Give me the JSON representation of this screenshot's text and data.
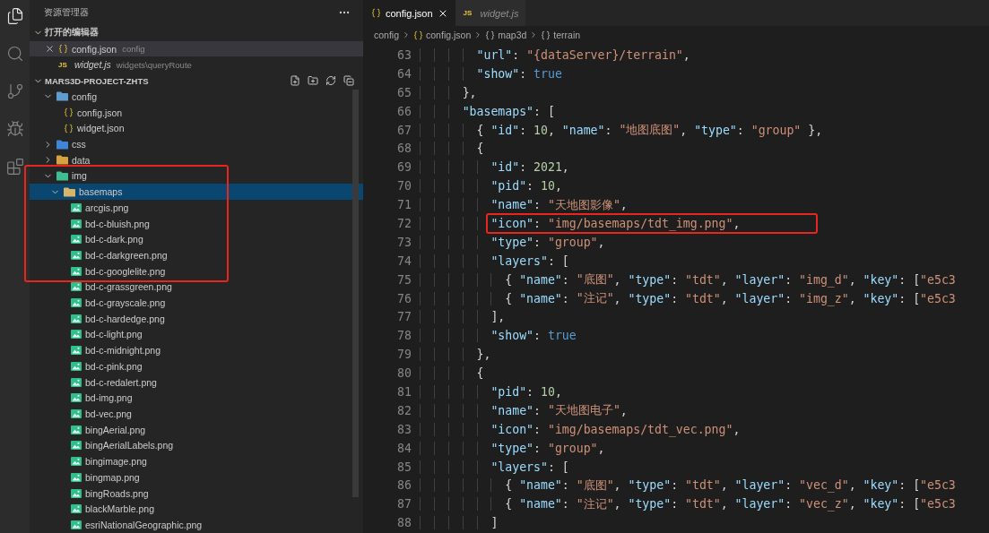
{
  "activity_bar": [
    {
      "kind": "explorer",
      "selected": true
    },
    {
      "kind": "search",
      "selected": false
    },
    {
      "kind": "scm",
      "selected": false
    },
    {
      "kind": "debug",
      "selected": false
    },
    {
      "kind": "extensions",
      "selected": false
    }
  ],
  "explorer": {
    "title": "资源管理器",
    "open_editors": {
      "label": "打开的编辑器",
      "expanded": true,
      "items": [
        {
          "kind": "json",
          "name": "config.json",
          "path": "config",
          "selected": true,
          "preview": false
        },
        {
          "kind": "js",
          "icon_label": "JS",
          "name": "widget.js",
          "path": "widgets\\queryRoute",
          "selected": false,
          "preview": true
        }
      ]
    },
    "project": {
      "label": "MARS3D-PROJECT-ZHTS",
      "expanded": true,
      "tree": [
        {
          "kind": "folder",
          "name": "config",
          "color": "#5f9ccf",
          "expanded": true,
          "selected": false,
          "children": [
            {
              "kind": "json",
              "name": "config.json",
              "selected": false
            },
            {
              "kind": "json",
              "name": "widget.json",
              "selected": false
            }
          ]
        },
        {
          "kind": "folder",
          "name": "css",
          "color": "#3f86d6",
          "expanded": false,
          "selected": false
        },
        {
          "kind": "folder",
          "name": "data",
          "color": "#d8a23e",
          "expanded": false,
          "selected": false
        },
        {
          "kind": "folder",
          "name": "img",
          "color": "#3fbf8f",
          "expanded": true,
          "selected": false,
          "annotated": true,
          "children": [
            {
              "kind": "folder",
              "name": "basemaps",
              "color": "#d9b56c",
              "expanded": true,
              "selected": true,
              "annotated": true,
              "children": [
                {
                  "kind": "image",
                  "name": "arcgis.png",
                  "selected": false,
                  "annotated": true
                },
                {
                  "kind": "image",
                  "name": "bd-c-bluish.png",
                  "selected": false,
                  "annotated": true
                },
                {
                  "kind": "image",
                  "name": "bd-c-dark.png",
                  "selected": false,
                  "annotated": true
                },
                {
                  "kind": "image",
                  "name": "bd-c-darkgreen.png",
                  "selected": false,
                  "annotated": true
                },
                {
                  "kind": "image",
                  "name": "bd-c-googlelite.png",
                  "selected": false,
                  "annotated": true
                },
                {
                  "kind": "image",
                  "name": "bd-c-grassgreen.png",
                  "selected": false
                },
                {
                  "kind": "image",
                  "name": "bd-c-grayscale.png",
                  "selected": false
                },
                {
                  "kind": "image",
                  "name": "bd-c-hardedge.png",
                  "selected": false
                },
                {
                  "kind": "image",
                  "name": "bd-c-light.png",
                  "selected": false
                },
                {
                  "kind": "image",
                  "name": "bd-c-midnight.png",
                  "selected": false
                },
                {
                  "kind": "image",
                  "name": "bd-c-pink.png",
                  "selected": false
                },
                {
                  "kind": "image",
                  "name": "bd-c-redalert.png",
                  "selected": false
                },
                {
                  "kind": "image",
                  "name": "bd-img.png",
                  "selected": false
                },
                {
                  "kind": "image",
                  "name": "bd-vec.png",
                  "selected": false
                },
                {
                  "kind": "image",
                  "name": "bingAerial.png",
                  "selected": false
                },
                {
                  "kind": "image",
                  "name": "bingAerialLabels.png",
                  "selected": false
                },
                {
                  "kind": "image",
                  "name": "bingimage.png",
                  "selected": false
                },
                {
                  "kind": "image",
                  "name": "bingmap.png",
                  "selected": false
                },
                {
                  "kind": "image",
                  "name": "bingRoads.png",
                  "selected": false
                },
                {
                  "kind": "image",
                  "name": "blackMarble.png",
                  "selected": false
                },
                {
                  "kind": "image",
                  "name": "esriNationalGeographic.png",
                  "selected": false
                }
              ]
            }
          ]
        }
      ]
    }
  },
  "tabs": [
    {
      "kind": "json",
      "label": "config.json",
      "selected": true,
      "preview": false
    },
    {
      "kind": "js",
      "icon_label": "JS",
      "label": "widget.js",
      "selected": false,
      "preview": true
    }
  ],
  "breadcrumb": [
    {
      "kind": "folder",
      "label": "config"
    },
    {
      "kind": "json",
      "label": "config.json"
    },
    {
      "kind": "object",
      "label": "map3d"
    },
    {
      "kind": "object",
      "label": "terrain"
    }
  ],
  "code": [
    {
      "number": "63",
      "tokens": [
        {
          "kind": "key",
          "text": "        \"url\""
        },
        {
          "kind": "punct",
          "text": ": "
        },
        {
          "kind": "string",
          "text": "\"{dataServer}/terrain\""
        },
        {
          "kind": "punct",
          "text": ","
        }
      ]
    },
    {
      "number": "64",
      "tokens": [
        {
          "kind": "key",
          "text": "        \"show\""
        },
        {
          "kind": "punct",
          "text": ": "
        },
        {
          "kind": "bool",
          "text": "true"
        }
      ]
    },
    {
      "number": "65",
      "tokens": [
        {
          "kind": "punct",
          "text": "      },"
        }
      ]
    },
    {
      "number": "66",
      "tokens": [
        {
          "kind": "key",
          "text": "      \"basemaps\""
        },
        {
          "kind": "punct",
          "text": ": ["
        }
      ]
    },
    {
      "number": "67",
      "tokens": [
        {
          "kind": "punct",
          "text": "        { "
        },
        {
          "kind": "key",
          "text": "\"id\""
        },
        {
          "kind": "punct",
          "text": ": "
        },
        {
          "kind": "number",
          "text": "10"
        },
        {
          "kind": "punct",
          "text": ", "
        },
        {
          "kind": "key",
          "text": "\"name\""
        },
        {
          "kind": "punct",
          "text": ": "
        },
        {
          "kind": "string",
          "text": "\"地图底图\""
        },
        {
          "kind": "punct",
          "text": ", "
        },
        {
          "kind": "key",
          "text": "\"type\""
        },
        {
          "kind": "punct",
          "text": ": "
        },
        {
          "kind": "string",
          "text": "\"group\""
        },
        {
          "kind": "punct",
          "text": " },"
        }
      ]
    },
    {
      "number": "68",
      "tokens": [
        {
          "kind": "punct",
          "text": "        {"
        }
      ]
    },
    {
      "number": "69",
      "tokens": [
        {
          "kind": "key",
          "text": "          \"id\""
        },
        {
          "kind": "punct",
          "text": ": "
        },
        {
          "kind": "number",
          "text": "2021"
        },
        {
          "kind": "punct",
          "text": ","
        }
      ]
    },
    {
      "number": "70",
      "tokens": [
        {
          "kind": "key",
          "text": "          \"pid\""
        },
        {
          "kind": "punct",
          "text": ": "
        },
        {
          "kind": "number",
          "text": "10"
        },
        {
          "kind": "punct",
          "text": ","
        }
      ]
    },
    {
      "number": "71",
      "tokens": [
        {
          "kind": "key",
          "text": "          \"name\""
        },
        {
          "kind": "punct",
          "text": ": "
        },
        {
          "kind": "string",
          "text": "\"天地图影像\""
        },
        {
          "kind": "punct",
          "text": ","
        }
      ]
    },
    {
      "number": "72",
      "annotated": true,
      "tokens": [
        {
          "kind": "key",
          "text": "          \"icon\""
        },
        {
          "kind": "punct",
          "text": ": "
        },
        {
          "kind": "string",
          "text": "\"img/basemaps/tdt_img.png\""
        },
        {
          "kind": "punct",
          "text": ","
        }
      ]
    },
    {
      "number": "73",
      "tokens": [
        {
          "kind": "key",
          "text": "          \"type\""
        },
        {
          "kind": "punct",
          "text": ": "
        },
        {
          "kind": "string",
          "text": "\"group\""
        },
        {
          "kind": "punct",
          "text": ","
        }
      ]
    },
    {
      "number": "74",
      "tokens": [
        {
          "kind": "key",
          "text": "          \"layers\""
        },
        {
          "kind": "punct",
          "text": ": ["
        }
      ]
    },
    {
      "number": "75",
      "tokens": [
        {
          "kind": "punct",
          "text": "            { "
        },
        {
          "kind": "key",
          "text": "\"name\""
        },
        {
          "kind": "punct",
          "text": ": "
        },
        {
          "kind": "string",
          "text": "\"底图\""
        },
        {
          "kind": "punct",
          "text": ", "
        },
        {
          "kind": "key",
          "text": "\"type\""
        },
        {
          "kind": "punct",
          "text": ": "
        },
        {
          "kind": "string",
          "text": "\"tdt\""
        },
        {
          "kind": "punct",
          "text": ", "
        },
        {
          "kind": "key",
          "text": "\"layer\""
        },
        {
          "kind": "punct",
          "text": ": "
        },
        {
          "kind": "string",
          "text": "\"img_d\""
        },
        {
          "kind": "punct",
          "text": ", "
        },
        {
          "kind": "key",
          "text": "\"key\""
        },
        {
          "kind": "punct",
          "text": ": ["
        },
        {
          "kind": "string",
          "text": "\"e5c3"
        }
      ]
    },
    {
      "number": "76",
      "tokens": [
        {
          "kind": "punct",
          "text": "            { "
        },
        {
          "kind": "key",
          "text": "\"name\""
        },
        {
          "kind": "punct",
          "text": ": "
        },
        {
          "kind": "string",
          "text": "\"注记\""
        },
        {
          "kind": "punct",
          "text": ", "
        },
        {
          "kind": "key",
          "text": "\"type\""
        },
        {
          "kind": "punct",
          "text": ": "
        },
        {
          "kind": "string",
          "text": "\"tdt\""
        },
        {
          "kind": "punct",
          "text": ", "
        },
        {
          "kind": "key",
          "text": "\"layer\""
        },
        {
          "kind": "punct",
          "text": ": "
        },
        {
          "kind": "string",
          "text": "\"img_z\""
        },
        {
          "kind": "punct",
          "text": ", "
        },
        {
          "kind": "key",
          "text": "\"key\""
        },
        {
          "kind": "punct",
          "text": ": ["
        },
        {
          "kind": "string",
          "text": "\"e5c3"
        }
      ]
    },
    {
      "number": "77",
      "tokens": [
        {
          "kind": "punct",
          "text": "          ],"
        }
      ]
    },
    {
      "number": "78",
      "tokens": [
        {
          "kind": "key",
          "text": "          \"show\""
        },
        {
          "kind": "punct",
          "text": ": "
        },
        {
          "kind": "bool",
          "text": "true"
        }
      ]
    },
    {
      "number": "79",
      "tokens": [
        {
          "kind": "punct",
          "text": "        },"
        }
      ]
    },
    {
      "number": "80",
      "tokens": [
        {
          "kind": "punct",
          "text": "        {"
        }
      ]
    },
    {
      "number": "81",
      "tokens": [
        {
          "kind": "key",
          "text": "          \"pid\""
        },
        {
          "kind": "punct",
          "text": ": "
        },
        {
          "kind": "number",
          "text": "10"
        },
        {
          "kind": "punct",
          "text": ","
        }
      ]
    },
    {
      "number": "82",
      "tokens": [
        {
          "kind": "key",
          "text": "          \"name\""
        },
        {
          "kind": "punct",
          "text": ": "
        },
        {
          "kind": "string",
          "text": "\"天地图电子\""
        },
        {
          "kind": "punct",
          "text": ","
        }
      ]
    },
    {
      "number": "83",
      "tokens": [
        {
          "kind": "key",
          "text": "          \"icon\""
        },
        {
          "kind": "punct",
          "text": ": "
        },
        {
          "kind": "string",
          "text": "\"img/basemaps/tdt_vec.png\""
        },
        {
          "kind": "punct",
          "text": ","
        }
      ]
    },
    {
      "number": "84",
      "tokens": [
        {
          "kind": "key",
          "text": "          \"type\""
        },
        {
          "kind": "punct",
          "text": ": "
        },
        {
          "kind": "string",
          "text": "\"group\""
        },
        {
          "kind": "punct",
          "text": ","
        }
      ]
    },
    {
      "number": "85",
      "tokens": [
        {
          "kind": "key",
          "text": "          \"layers\""
        },
        {
          "kind": "punct",
          "text": ": ["
        }
      ]
    },
    {
      "number": "86",
      "tokens": [
        {
          "kind": "punct",
          "text": "            { "
        },
        {
          "kind": "key",
          "text": "\"name\""
        },
        {
          "kind": "punct",
          "text": ": "
        },
        {
          "kind": "string",
          "text": "\"底图\""
        },
        {
          "kind": "punct",
          "text": ", "
        },
        {
          "kind": "key",
          "text": "\"type\""
        },
        {
          "kind": "punct",
          "text": ": "
        },
        {
          "kind": "string",
          "text": "\"tdt\""
        },
        {
          "kind": "punct",
          "text": ", "
        },
        {
          "kind": "key",
          "text": "\"layer\""
        },
        {
          "kind": "punct",
          "text": ": "
        },
        {
          "kind": "string",
          "text": "\"vec_d\""
        },
        {
          "kind": "punct",
          "text": ", "
        },
        {
          "kind": "key",
          "text": "\"key\""
        },
        {
          "kind": "punct",
          "text": ": ["
        },
        {
          "kind": "string",
          "text": "\"e5c3"
        }
      ]
    },
    {
      "number": "87",
      "tokens": [
        {
          "kind": "punct",
          "text": "            { "
        },
        {
          "kind": "key",
          "text": "\"name\""
        },
        {
          "kind": "punct",
          "text": ": "
        },
        {
          "kind": "string",
          "text": "\"注记\""
        },
        {
          "kind": "punct",
          "text": ", "
        },
        {
          "kind": "key",
          "text": "\"type\""
        },
        {
          "kind": "punct",
          "text": ": "
        },
        {
          "kind": "string",
          "text": "\"tdt\""
        },
        {
          "kind": "punct",
          "text": ", "
        },
        {
          "kind": "key",
          "text": "\"layer\""
        },
        {
          "kind": "punct",
          "text": ": "
        },
        {
          "kind": "string",
          "text": "\"vec_z\""
        },
        {
          "kind": "punct",
          "text": ", "
        },
        {
          "kind": "key",
          "text": "\"key\""
        },
        {
          "kind": "punct",
          "text": ": ["
        },
        {
          "kind": "string",
          "text": "\"e5c3"
        }
      ]
    },
    {
      "number": "88",
      "tokens": [
        {
          "kind": "punct",
          "text": "          ]"
        }
      ]
    }
  ]
}
